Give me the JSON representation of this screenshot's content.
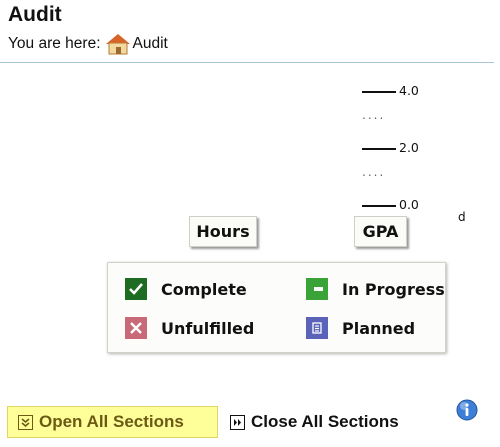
{
  "page": {
    "title": "Audit"
  },
  "breadcrumb": {
    "prefix": "You are here:",
    "current": "Audit",
    "home_icon": "home-icon"
  },
  "gpa_scale": {
    "ticks": [
      "4.0",
      "2.0",
      "0.0"
    ],
    "separator": "....",
    "trailing_mark": "d"
  },
  "graph_buttons": {
    "hours": "Hours",
    "gpa": "GPA"
  },
  "legend": {
    "complete": {
      "label": "Complete",
      "icon": "check-icon",
      "color": "#1e6b22"
    },
    "in_progress": {
      "label": "In Progress",
      "icon": "progress-icon",
      "color": "#39a337"
    },
    "unfulfilled": {
      "label": "Unfulfilled",
      "icon": "x-icon",
      "color": "#c86a78"
    },
    "planned": {
      "label": "Planned",
      "icon": "planned-icon",
      "color": "#5a63b8"
    }
  },
  "sections": {
    "open_label": "Open All Sections",
    "close_label": "Close All Sections",
    "info_icon": "info-icon"
  }
}
